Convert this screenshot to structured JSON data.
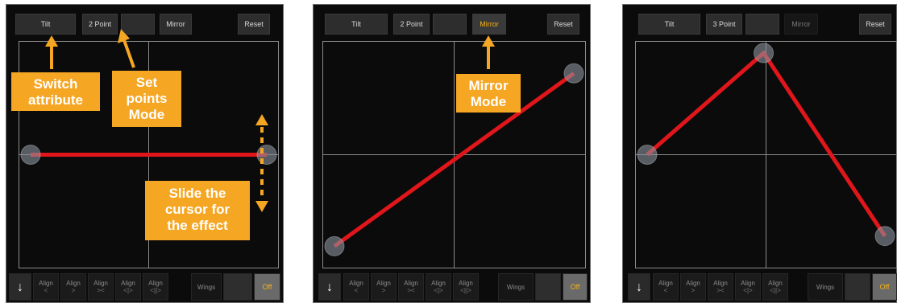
{
  "panels": [
    {
      "buttons": [
        {
          "label": "Tilt",
          "state": "normal"
        },
        {
          "label": "2 Point",
          "state": "normal"
        },
        {
          "label": "",
          "state": "normal"
        },
        {
          "label": "Mirror",
          "state": "normal"
        },
        {
          "label": "Reset",
          "state": "normal"
        }
      ],
      "points": [
        [
          0,
          0
        ],
        [
          1,
          0
        ]
      ]
    },
    {
      "buttons": [
        {
          "label": "Tilt",
          "state": "normal"
        },
        {
          "label": "2 Point",
          "state": "normal"
        },
        {
          "label": "",
          "state": "normal"
        },
        {
          "label": "Mirror",
          "state": "active"
        },
        {
          "label": "Reset",
          "state": "normal"
        }
      ],
      "points": [
        [
          0,
          -0.45
        ],
        [
          1,
          0.4
        ]
      ]
    },
    {
      "buttons": [
        {
          "label": "Tilt",
          "state": "normal"
        },
        {
          "label": "3 Point",
          "state": "normal"
        },
        {
          "label": "",
          "state": "normal"
        },
        {
          "label": "Mirror",
          "state": "dim"
        },
        {
          "label": "Reset",
          "state": "normal"
        }
      ],
      "points": [
        [
          0,
          0
        ],
        [
          0.49,
          0.5
        ],
        [
          1,
          -0.4
        ]
      ]
    }
  ],
  "bottom_bar": {
    "down_arrow": "↓",
    "align_label": "Align",
    "align_glyphs": [
      "<",
      ">",
      "><",
      "<|>",
      "<||>"
    ],
    "wings_label": "Wings",
    "off_label": "Off"
  },
  "annotations": {
    "switch_attribute": [
      "Switch",
      "attribute"
    ],
    "set_points_mode": [
      "Set",
      "points",
      "Mode"
    ],
    "slide_cursor": [
      "Slide the",
      "cursor for",
      "the effect"
    ],
    "mirror_mode": [
      "Mirror",
      "Mode"
    ]
  },
  "colors": {
    "accent": "#f5a623",
    "line": "#e0161b",
    "active_text": "#f5b21a"
  }
}
